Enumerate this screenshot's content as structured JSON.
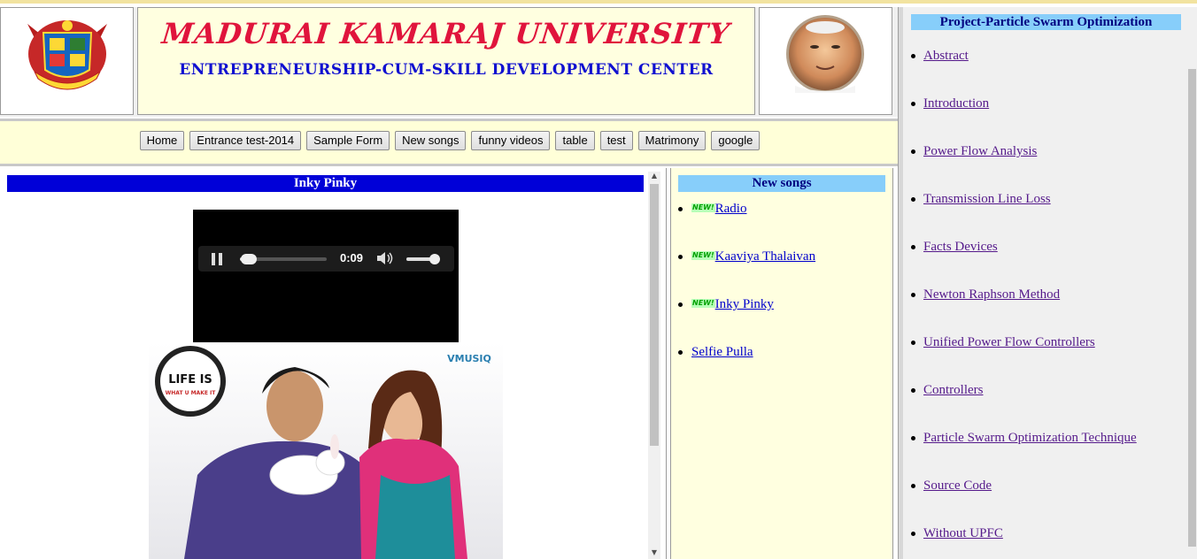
{
  "header": {
    "university_title": "MADURAI KAMARAJ UNIVERSITY",
    "subtitle": "ENTREPRENEURSHIP-CUM-SKILL DEVELOPMENT CENTER"
  },
  "nav": {
    "buttons": [
      "Home",
      "Entrance test-2014",
      "Sample Form",
      "New songs",
      "funny videos",
      "table",
      "test",
      "Matrimony",
      "google"
    ]
  },
  "content": {
    "song_title": "Inky Pinky",
    "player": {
      "time": "0:09",
      "progress": 0.1,
      "volume": 0.85
    },
    "poster": {
      "badge_line1": "LIFE IS",
      "badge_line2": "WHAT U MAKE IT",
      "brand": "VMUSIQ"
    }
  },
  "songs": {
    "heading": "New songs",
    "new_badge": "NEW!",
    "items": [
      {
        "label": "Radio",
        "is_new": true
      },
      {
        "label": "Kaaviya Thalaivan",
        "is_new": true
      },
      {
        "label": "Inky Pinky",
        "is_new": true
      },
      {
        "label": "Selfie Pulla",
        "is_new": false
      }
    ]
  },
  "project": {
    "heading": "Project-Particle Swarm Optimization",
    "topics": [
      "Abstract",
      "Introduction",
      "Power Flow Analysis",
      "Transmission Line Loss",
      "Facts Devices",
      "Newton Raphson Method",
      "Unified Power Flow Controllers",
      "Controllers",
      "Particle Swarm Optimization Technique",
      "Source Code",
      "Without UPFC"
    ]
  },
  "colors": {
    "title_red": "#e0143c",
    "subtitle_blue": "#1010d0",
    "song_header_bg": "#0000d8",
    "side_header_bg": "#87cefa",
    "cream": "#ffffe0"
  }
}
